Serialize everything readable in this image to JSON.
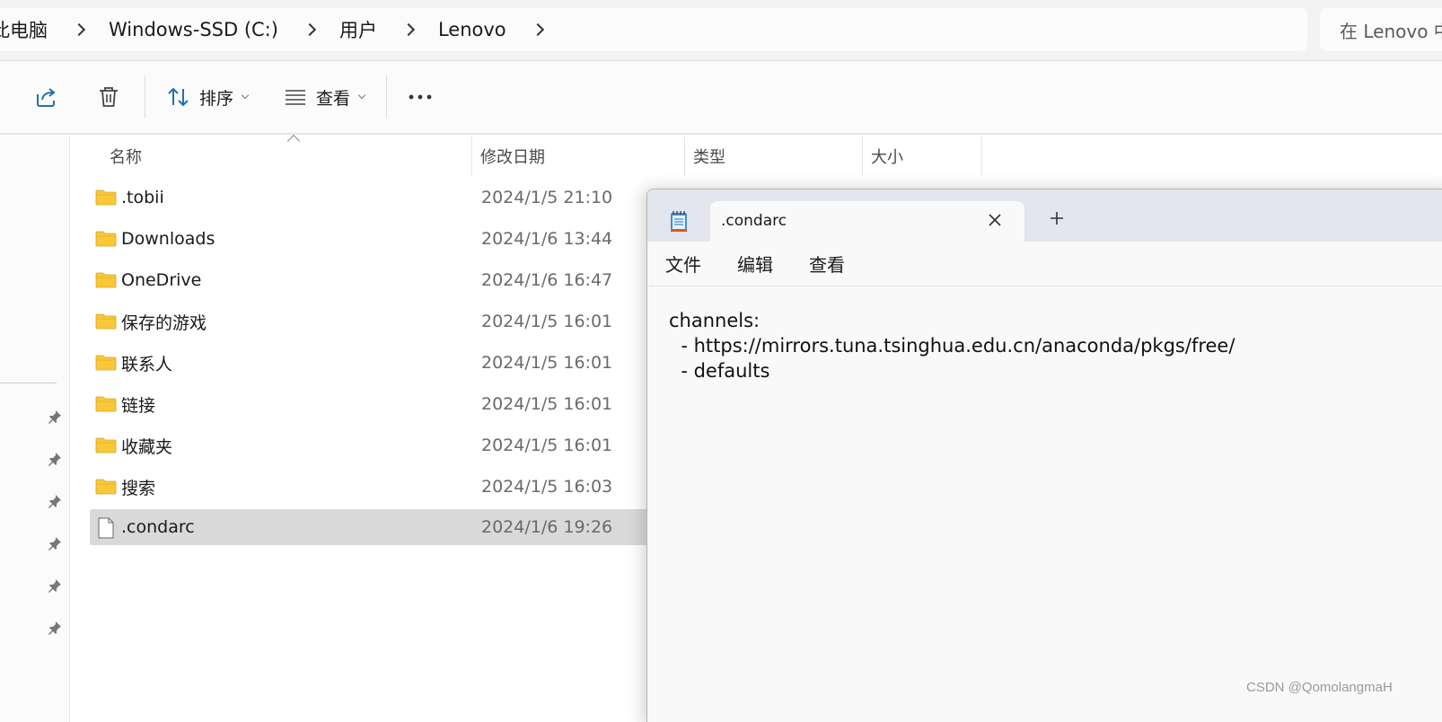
{
  "address_bar": {
    "breadcrumbs": [
      "此电脑",
      "Windows-SSD (C:)",
      "用户",
      "Lenovo"
    ],
    "search_placeholder": "在 Lenovo 中搜索"
  },
  "toolbar": {
    "sort_label": "排序",
    "view_label": "查看"
  },
  "file_list": {
    "columns": [
      "名称",
      "修改日期",
      "类型",
      "大小"
    ],
    "rows": [
      {
        "name": ".tobii",
        "date": "2024/1/5 21:10",
        "kind": "folder"
      },
      {
        "name": "Downloads",
        "date": "2024/1/6 13:44",
        "kind": "folder"
      },
      {
        "name": "OneDrive",
        "date": "2024/1/6 16:47",
        "kind": "folder"
      },
      {
        "name": "保存的游戏",
        "date": "2024/1/5 16:01",
        "kind": "folder"
      },
      {
        "name": "联系人",
        "date": "2024/1/5 16:01",
        "kind": "folder"
      },
      {
        "name": "链接",
        "date": "2024/1/5 16:01",
        "kind": "folder"
      },
      {
        "name": "收藏夹",
        "date": "2024/1/5 16:01",
        "kind": "folder"
      },
      {
        "name": "搜索",
        "date": "2024/1/5 16:03",
        "kind": "folder"
      },
      {
        "name": ".condarc",
        "date": "2024/1/6 19:26",
        "kind": "file",
        "selected": true
      }
    ]
  },
  "notepad": {
    "tab_title": ".condarc",
    "menu": [
      "文件",
      "编辑",
      "查看"
    ],
    "content_lines": [
      "channels:",
      "  - https://mirrors.tuna.tsinghua.edu.cn/anaconda/pkgs/free/",
      "  - defaults"
    ]
  },
  "watermark": "CSDN @QomolangmaH",
  "colors": {
    "folder_yellow": "#f8c838",
    "selected_row": "#d9d9d9",
    "accent_blue": "#1f6fb5"
  }
}
